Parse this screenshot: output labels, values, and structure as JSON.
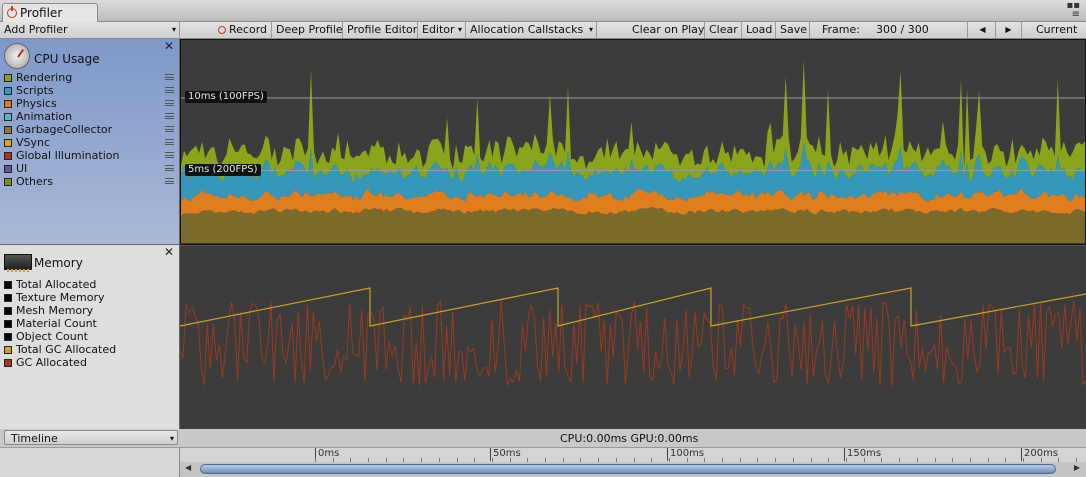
{
  "window": {
    "tab_title": "Profiler",
    "controls": [
      "▪▪",
      "≡"
    ]
  },
  "toolbar": {
    "add_profiler": "Add Profiler",
    "record": "Record",
    "deep_profile": "Deep Profile",
    "profile_editor": "Profile Editor",
    "editor": "Editor",
    "allocation_callstacks": "Allocation Callstacks",
    "clear_on_play": "Clear on Play",
    "clear": "Clear",
    "load": "Load",
    "save": "Save",
    "frame_label": "Frame:",
    "frame_value": "300 / 300",
    "prev": "◀",
    "next": "▶",
    "current": "Current"
  },
  "cpu": {
    "title": "CPU Usage",
    "close": "✕",
    "legend": [
      {
        "label": "Rendering",
        "color": "#8aa51a"
      },
      {
        "label": "Scripts",
        "color": "#3597b9"
      },
      {
        "label": "Physics",
        "color": "#e07d1f"
      },
      {
        "label": "Animation",
        "color": "#4fb8c5"
      },
      {
        "label": "GarbageCollector",
        "color": "#8f7a30"
      },
      {
        "label": "VSync",
        "color": "#d9a51c"
      },
      {
        "label": "Global Illumination",
        "color": "#a33a22"
      },
      {
        "label": "UI",
        "color": "#6f4ea3"
      },
      {
        "label": "Others",
        "color": "#7e8f1f"
      }
    ],
    "lines": [
      {
        "label": "10ms (100FPS)",
        "value_ms": 10
      },
      {
        "label": "5ms (200FPS)",
        "value_ms": 5
      }
    ]
  },
  "memory": {
    "title": "Memory",
    "close": "✕",
    "legend": [
      {
        "label": "Total Allocated",
        "color": "#000000"
      },
      {
        "label": "Texture Memory",
        "color": "#000000"
      },
      {
        "label": "Mesh Memory",
        "color": "#000000"
      },
      {
        "label": "Material Count",
        "color": "#000000"
      },
      {
        "label": "Object Count",
        "color": "#000000"
      },
      {
        "label": "Total GC Allocated",
        "color": "#c9a227"
      },
      {
        "label": "GC Allocated",
        "color": "#9a3a1e"
      }
    ]
  },
  "bottom": {
    "view_mode": "Timeline",
    "cpu_gpu": "CPU:0.00ms  GPU:0.00ms",
    "ruler": [
      "0ms",
      "50ms",
      "100ms",
      "150ms",
      "200ms"
    ]
  }
}
